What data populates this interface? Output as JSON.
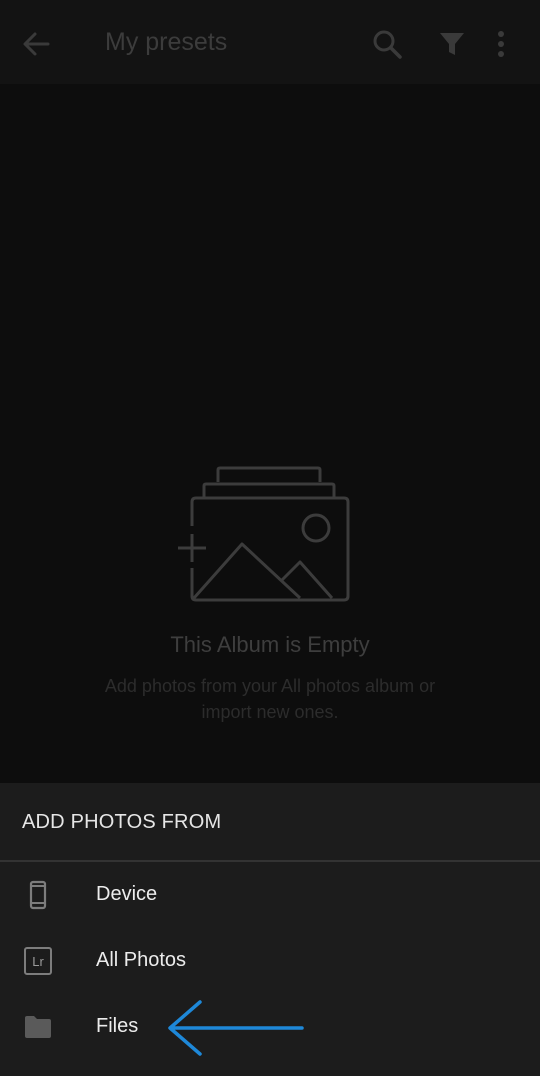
{
  "toolbar": {
    "title": "My presets",
    "back_icon": "back-arrow-icon",
    "search_icon": "search-icon",
    "filter_icon": "filter-icon",
    "more_icon": "more-vertical-icon"
  },
  "empty_state": {
    "icon": "add-photo-stack-icon",
    "title": "This Album is Empty",
    "description": "Add photos from your All photos album or import new ones."
  },
  "sheet": {
    "header": "ADD PHOTOS FROM",
    "items": [
      {
        "label": "Device",
        "icon": "phone-icon"
      },
      {
        "label": "All Photos",
        "icon": "lightroom-icon",
        "icon_text": "Lr"
      },
      {
        "label": "Files",
        "icon": "folder-icon"
      }
    ]
  },
  "annotation": {
    "icon": "pointer-arrow-icon",
    "color": "#1e88d8"
  }
}
